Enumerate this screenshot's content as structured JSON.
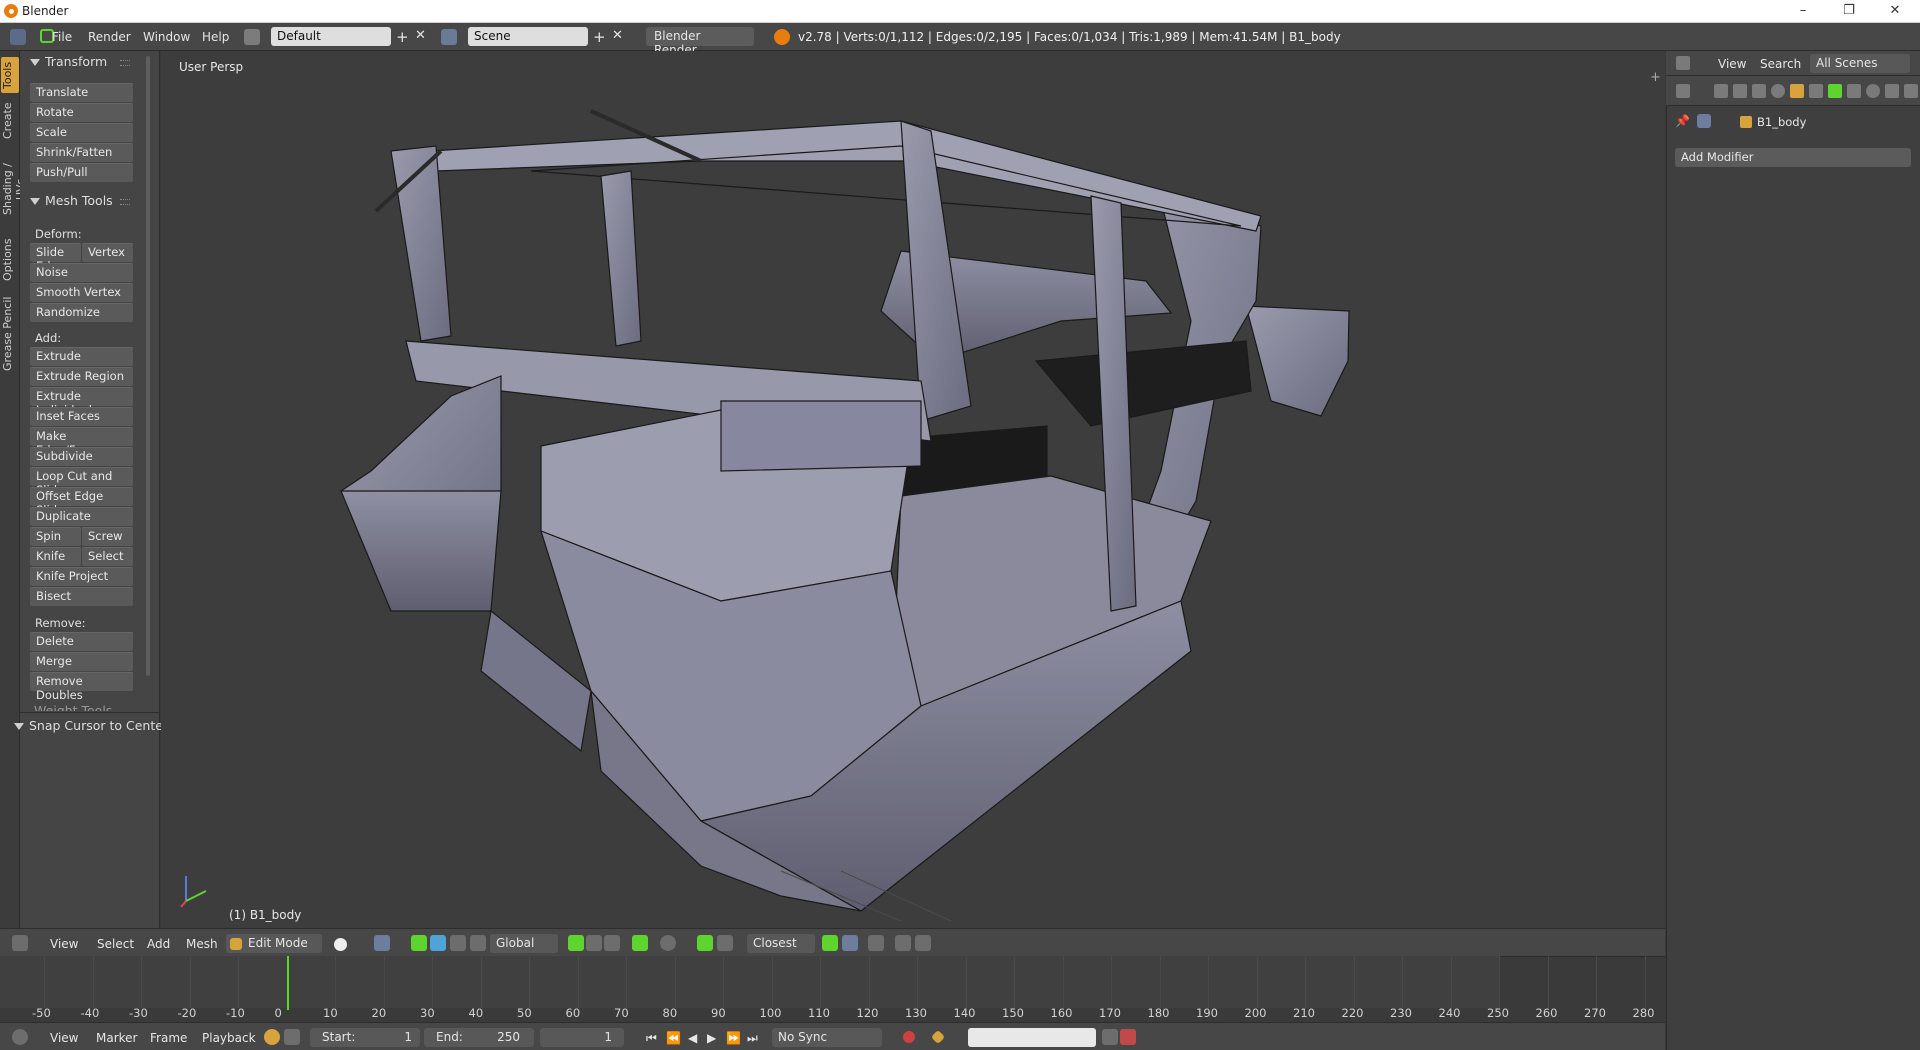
{
  "window": {
    "title": "Blender",
    "controls": [
      "–",
      "❐",
      "✕"
    ]
  },
  "info_header": {
    "menus": [
      "File",
      "Render",
      "Window",
      "Help"
    ],
    "layout": "Default",
    "scene": "Scene",
    "engine": "Blender Render",
    "stats": "v2.78 | Verts:0/1,112 | Edges:0/2,195 | Faces:0/1,034 | Tris:1,989 | Mem:41.54M | B1_body"
  },
  "tool_tabs": [
    "Tools",
    "Create",
    "Shading / UVs",
    "Options",
    "Grease Pencil"
  ],
  "tool_shelf": {
    "transform_title": "Transform",
    "transform": [
      "Translate",
      "Rotate",
      "Scale",
      "Shrink/Fatten",
      "Push/Pull"
    ],
    "mesh_tools_title": "Mesh Tools",
    "deform_label": "Deform:",
    "deform_pair": [
      "Slide Ed",
      "Vertex"
    ],
    "deform": [
      "Noise",
      "Smooth Vertex",
      "Randomize"
    ],
    "add_label": "Add:",
    "add": [
      "Extrude",
      "Extrude Region",
      "Extrude Individual",
      "Inset Faces",
      "Make Edge/Face",
      "Subdivide",
      "Loop Cut and Slide",
      "Offset Edge Slide",
      "Duplicate"
    ],
    "spin_pair": [
      "Spin",
      "Screw"
    ],
    "knife_pair": [
      "Knife",
      "Select"
    ],
    "add_more": [
      "Knife Project",
      "Bisect"
    ],
    "remove_label": "Remove:",
    "remove": [
      "Delete",
      "Merge",
      "Remove Doubles"
    ],
    "weight_tools": "Weight Tools",
    "snap_cursor": "Snap Cursor to Center"
  },
  "viewport": {
    "persp_label": "User Persp",
    "object_label": "(1) B1_body"
  },
  "view_header": {
    "menus": [
      "View",
      "Select",
      "Add",
      "Mesh"
    ],
    "mode": "Edit Mode",
    "orientation": "Global",
    "snap": "Closest"
  },
  "timeline": {
    "ticks": [
      -50,
      -40,
      -30,
      -20,
      -10,
      0,
      10,
      20,
      30,
      40,
      50,
      60,
      70,
      80,
      90,
      100,
      110,
      120,
      130,
      140,
      150,
      160,
      170,
      180,
      190,
      200,
      210,
      220,
      230,
      240,
      250,
      260,
      270,
      280
    ],
    "current_frame": 1,
    "menus": [
      "View",
      "Marker",
      "Frame",
      "Playback"
    ],
    "start_label": "Start:",
    "start": "1",
    "end_label": "End:",
    "end": "250",
    "frame": "1",
    "sync": "No Sync"
  },
  "properties": {
    "outliner_menus": [
      "View",
      "Search"
    ],
    "outliner_filter": "All Scenes",
    "object_name": "B1_body",
    "add_modifier": "Add Modifier"
  },
  "colors": {
    "accent_green": "#5ed52e",
    "tab_active": "#d8a23c",
    "mesh_face": "#8a8a9c"
  }
}
